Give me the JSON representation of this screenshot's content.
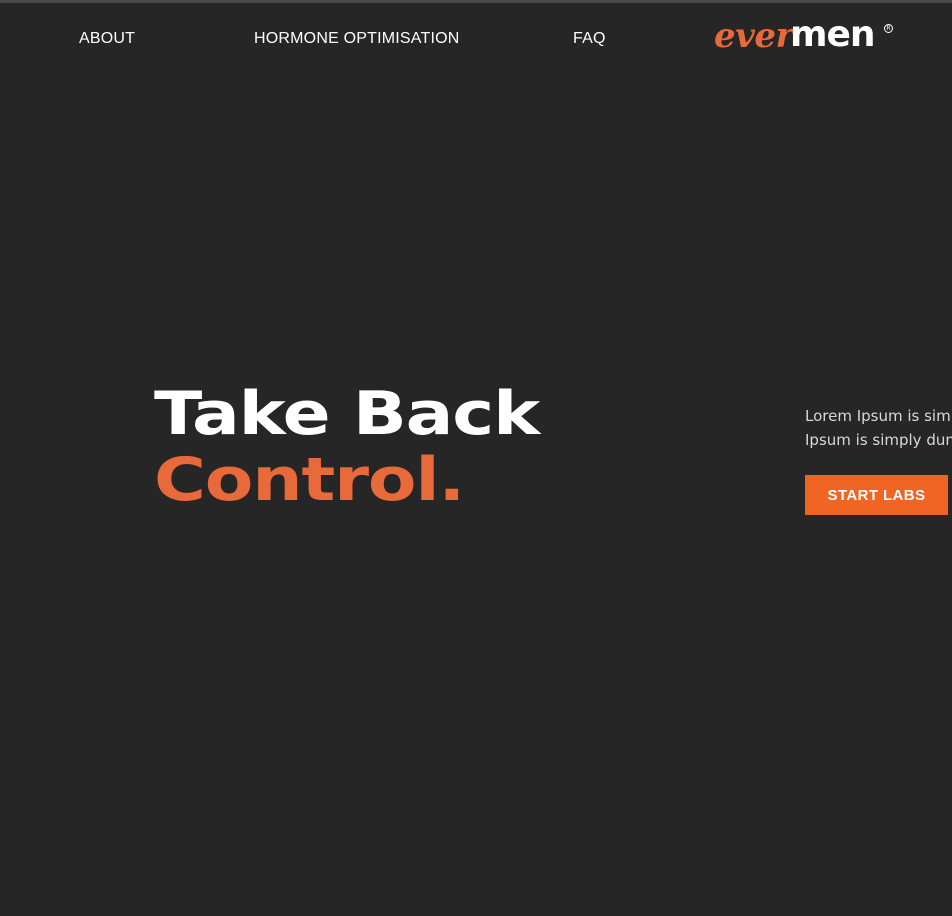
{
  "nav": {
    "items": [
      {
        "label": "ABOUT"
      },
      {
        "label": "HORMONE OPTIMISATION"
      },
      {
        "label": "FAQ"
      }
    ]
  },
  "logo": {
    "part1": "ever",
    "part2": "men",
    "registered": "R"
  },
  "hero": {
    "headline_line1": "Take Back",
    "headline_line2": "Control.",
    "body_line1": "Lorem Ipsum is simp",
    "body_line2": "Ipsum is simply dum",
    "cta_label": "START LABS"
  },
  "colors": {
    "background": "#262626",
    "accent": "#e8693a",
    "button": "#f06424",
    "text": "#ffffff"
  }
}
